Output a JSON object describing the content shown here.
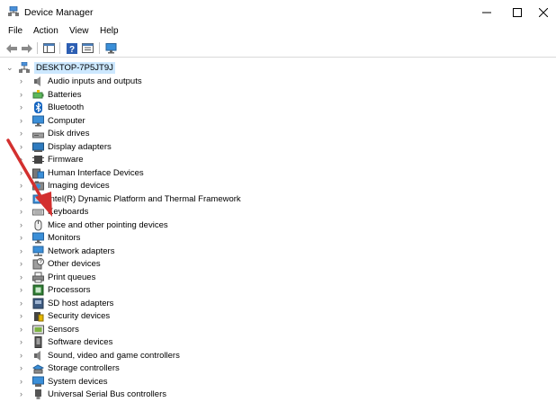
{
  "window": {
    "title": "Device Manager",
    "controls": [
      "minimize",
      "maximize",
      "close"
    ]
  },
  "menu": {
    "items": [
      "File",
      "Action",
      "View",
      "Help"
    ]
  },
  "toolbar": {
    "buttons": [
      "back-icon",
      "forward-icon",
      "show-hide-console-tree-icon",
      "help-icon",
      "properties-icon",
      "scan-hardware-icon"
    ]
  },
  "tree": {
    "root": "DESKTOP-7P5JT9J",
    "items": [
      {
        "label": "Audio inputs and outputs",
        "icon": "speaker-icon"
      },
      {
        "label": "Batteries",
        "icon": "battery-icon"
      },
      {
        "label": "Bluetooth",
        "icon": "bluetooth-icon"
      },
      {
        "label": "Computer",
        "icon": "monitor-icon"
      },
      {
        "label": "Disk drives",
        "icon": "disk-drive-icon"
      },
      {
        "label": "Display adapters",
        "icon": "display-adapter-icon"
      },
      {
        "label": "Firmware",
        "icon": "firmware-icon"
      },
      {
        "label": "Human Interface Devices",
        "icon": "hid-icon"
      },
      {
        "label": "Imaging devices",
        "icon": "camera-icon"
      },
      {
        "label": "Intel(R) Dynamic Platform and Thermal Framework",
        "icon": "chip-icon"
      },
      {
        "label": "Keyboards",
        "icon": "keyboard-icon"
      },
      {
        "label": "Mice and other pointing devices",
        "icon": "mouse-icon"
      },
      {
        "label": "Monitors",
        "icon": "monitor-icon"
      },
      {
        "label": "Network adapters",
        "icon": "network-icon"
      },
      {
        "label": "Other devices",
        "icon": "unknown-device-icon"
      },
      {
        "label": "Print queues",
        "icon": "printer-icon"
      },
      {
        "label": "Processors",
        "icon": "processor-icon"
      },
      {
        "label": "SD host adapters",
        "icon": "sd-card-icon"
      },
      {
        "label": "Security devices",
        "icon": "security-icon"
      },
      {
        "label": "Sensors",
        "icon": "sensor-icon"
      },
      {
        "label": "Software devices",
        "icon": "software-device-icon"
      },
      {
        "label": "Sound, video and game controllers",
        "icon": "speaker-icon"
      },
      {
        "label": "Storage controllers",
        "icon": "storage-icon"
      },
      {
        "label": "System devices",
        "icon": "system-device-icon"
      },
      {
        "label": "Universal Serial Bus controllers",
        "icon": "usb-icon"
      }
    ]
  },
  "colors": {
    "selection": "#cce8ff",
    "annotation_arrow": "#d3302f",
    "accent_blue": "#1e88e5"
  }
}
